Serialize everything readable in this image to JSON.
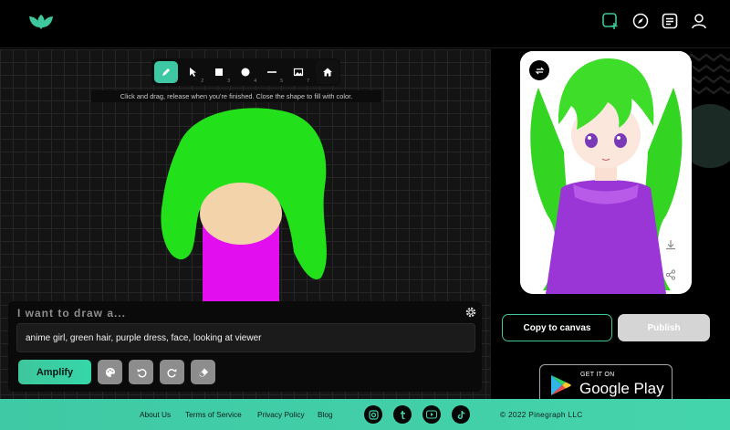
{
  "header": {
    "icons": [
      "leaf-logo",
      "new-canvas-icon",
      "compass-icon",
      "document-icon",
      "user-icon"
    ],
    "accent": "#3ec69c"
  },
  "toolbar": {
    "tools": [
      {
        "name": "pencil-icon",
        "shortcut": "1"
      },
      {
        "name": "cursor-icon",
        "shortcut": "2"
      },
      {
        "name": "square-icon",
        "shortcut": "3"
      },
      {
        "name": "circle-icon",
        "shortcut": "4"
      },
      {
        "name": "line-icon",
        "shortcut": "5"
      },
      {
        "name": "image-icon",
        "shortcut": "7"
      }
    ],
    "hint": "Click and drag, release when you're finished. Close the shape to fill with color."
  },
  "prompt": {
    "title": "I want to draw a...",
    "value": "anime girl, green hair, purple dress, face, looking at viewer",
    "amplify_label": "Amplify"
  },
  "result": {
    "copy_label": "Copy to canvas",
    "publish_label": "Publish"
  },
  "store_badge": {
    "small": "GET IT ON",
    "big": "Google Play"
  },
  "footer": {
    "links": [
      "About Us",
      "Terms of Service",
      "Privacy Policy",
      "Blog"
    ],
    "social": [
      "instagram-icon",
      "tumblr-icon",
      "youtube-icon",
      "tiktok-icon"
    ],
    "copyright": "© 2022 Pinegraph LLC"
  }
}
